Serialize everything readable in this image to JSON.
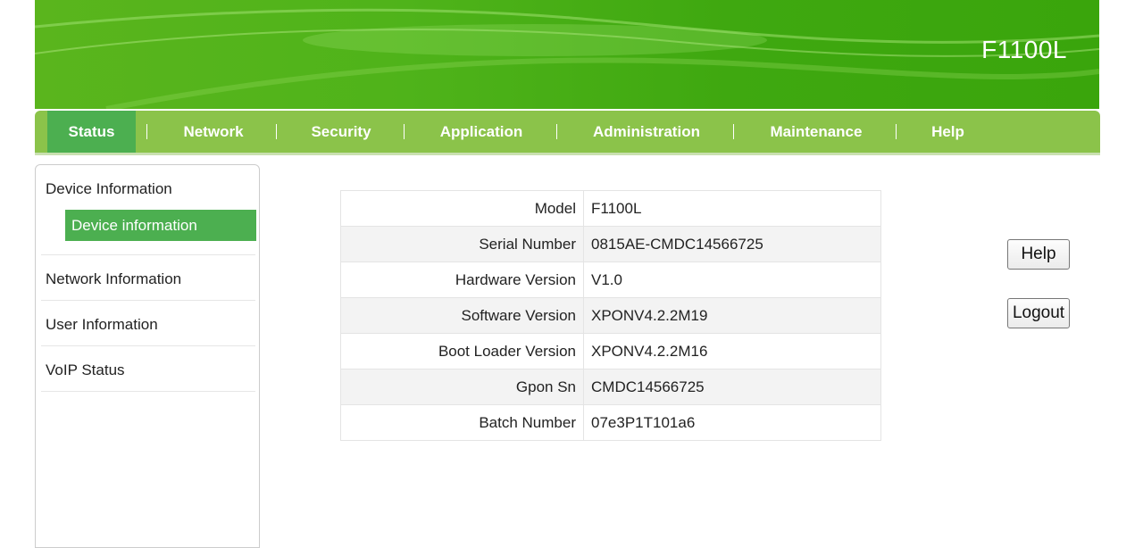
{
  "header": {
    "brand": "F1100L"
  },
  "nav": {
    "items": [
      {
        "label": "Status",
        "active": true
      },
      {
        "label": "Network"
      },
      {
        "label": "Security"
      },
      {
        "label": "Application"
      },
      {
        "label": "Administration"
      },
      {
        "label": "Maintenance"
      },
      {
        "label": "Help"
      }
    ]
  },
  "sidebar": {
    "groups": [
      {
        "label": "Device Information",
        "sub": [
          {
            "label": "Device information",
            "active": true
          }
        ]
      },
      {
        "label": "Network Information"
      },
      {
        "label": "User Information"
      },
      {
        "label": "VoIP Status"
      }
    ]
  },
  "device_info": {
    "rows": [
      {
        "label": "Model",
        "value": "F1100L"
      },
      {
        "label": "Serial Number",
        "value": "0815AE-CMDC14566725"
      },
      {
        "label": "Hardware Version",
        "value": "V1.0"
      },
      {
        "label": "Software Version",
        "value": "XPONV4.2.2M19"
      },
      {
        "label": "Boot Loader Version",
        "value": "XPONV4.2.2M16"
      },
      {
        "label": "Gpon Sn",
        "value": "CMDC14566725"
      },
      {
        "label": "Batch Number",
        "value": "07e3P1T101a6"
      }
    ]
  },
  "actions": {
    "help_label": "Help",
    "logout_label": "Logout"
  },
  "colors": {
    "banner": "#4fb31a",
    "nav": "#8bc34a",
    "active": "#4caf50"
  }
}
